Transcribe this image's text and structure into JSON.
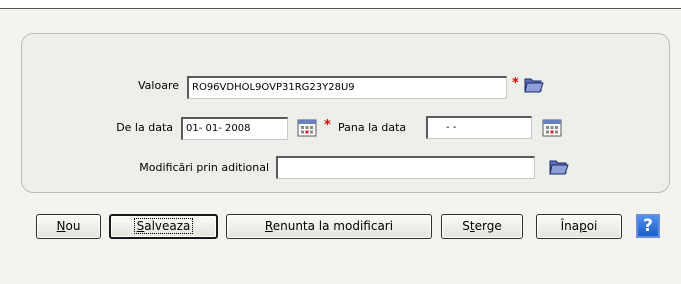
{
  "form": {
    "valoare": {
      "label": "Valoare",
      "value": "RO96VDHOL9OVP31RG23Y28U9",
      "required": true
    },
    "de_la_data": {
      "label": "De la data",
      "value": "01- 01-  2008",
      "required": true
    },
    "pana_la_data": {
      "label": "Pana la data",
      "value": "  -   -",
      "required": false
    },
    "modificari": {
      "label": "Modificări prin aditional",
      "value": ""
    },
    "required_mark": "*"
  },
  "buttons": {
    "nou": {
      "pre": "",
      "ul": "N",
      "post": "ou"
    },
    "salveaza": {
      "pre": "",
      "ul": "S",
      "post": "alveaza"
    },
    "renunta": {
      "pre": "",
      "ul": "R",
      "post": "enunta la modificari"
    },
    "sterge": {
      "pre": "S",
      "ul": "t",
      "post": "erge"
    },
    "inapoi": {
      "pre": "Îna",
      "ul": "p",
      "post": "oi"
    },
    "help": "?"
  },
  "colors": {
    "panel_bg": "#ecefea",
    "required": "#e60000",
    "help_blue": "#2a6ad8"
  },
  "icons": [
    "folder-icon",
    "calendar-icon",
    "help-icon"
  ]
}
